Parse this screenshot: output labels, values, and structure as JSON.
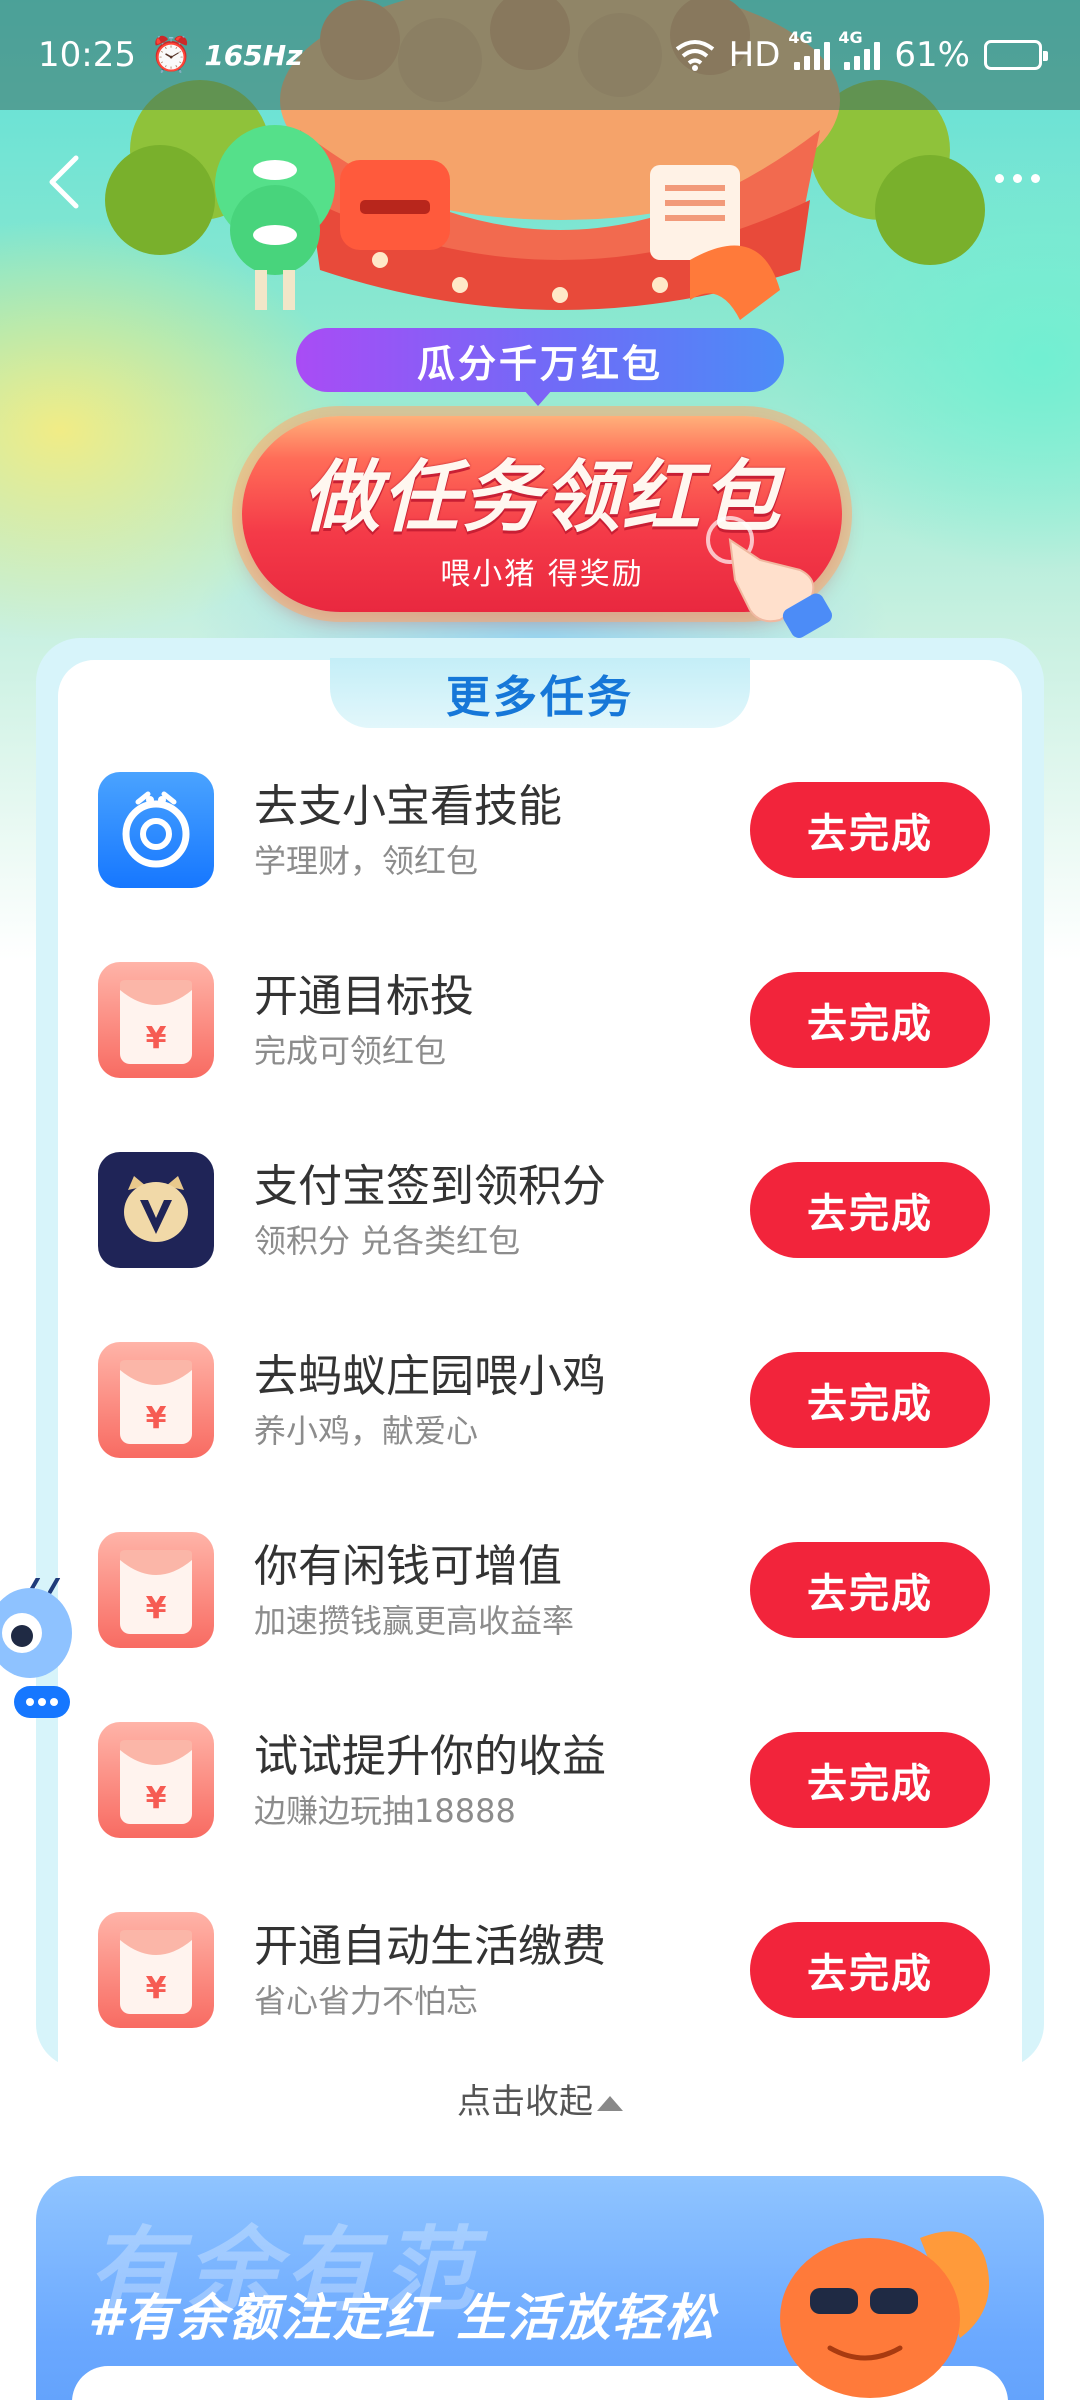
{
  "status_bar": {
    "time": "10:25",
    "refresh_rate": "165Hz",
    "network_label": "HD",
    "network_gen_1": "4G",
    "network_gen_2": "4G",
    "battery": "61%"
  },
  "banner": {
    "sub_pill": "瓜分千万红包",
    "cta_title": "做任务领红包",
    "cta_sub": "喂小猪 得奖励"
  },
  "tasks_section": {
    "title": "更多任务",
    "items": [
      {
        "title": "去支小宝看技能",
        "subtitle": "学理财，领红包",
        "button": "去完成",
        "icon": "alipay-assistant-icon"
      },
      {
        "title": "开通目标投",
        "subtitle": "完成可领红包",
        "button": "去完成",
        "icon": "red-packet-icon"
      },
      {
        "title": "支付宝签到领积分",
        "subtitle": "领积分 兑各类红包",
        "button": "去完成",
        "icon": "points-badge-icon"
      },
      {
        "title": "去蚂蚁庄园喂小鸡",
        "subtitle": "养小鸡，献爱心",
        "button": "去完成",
        "icon": "red-packet-icon"
      },
      {
        "title": "你有闲钱可增值",
        "subtitle": "加速攒钱赢更高收益率",
        "button": "去完成",
        "icon": "red-packet-icon"
      },
      {
        "title": "试试提升你的收益",
        "subtitle": "边赚边玩抽18888",
        "button": "去完成",
        "icon": "red-packet-icon"
      },
      {
        "title": "开通自动生活缴费",
        "subtitle": "省心省力不怕忘",
        "button": "去完成",
        "icon": "red-packet-icon"
      }
    ],
    "collapse_label": "点击收起"
  },
  "bottom_banner": {
    "bg_text": "有余有范",
    "slogan": "#有余额注定红 生活放轻松"
  },
  "colors": {
    "accent_red": "#f2243b",
    "section_blue": "#1677d8"
  }
}
